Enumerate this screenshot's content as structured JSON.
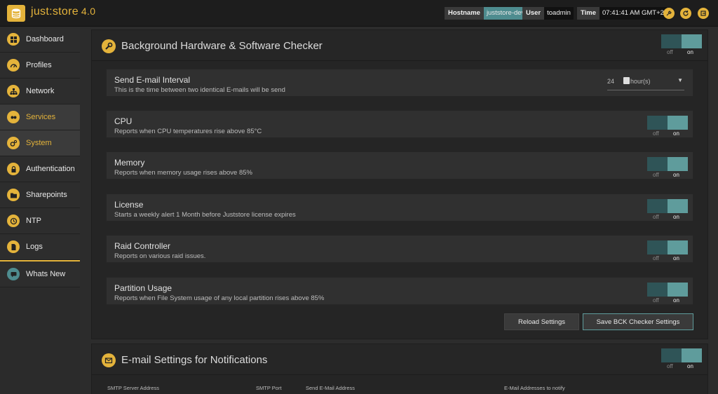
{
  "app": {
    "brand": "just:store",
    "version": "4.0"
  },
  "topbar": {
    "hostname_label": "Hostname",
    "hostname_value": "juststore-dev",
    "user_label": "User",
    "user_value": "toadmin",
    "time_label": "Time",
    "time_value": "07:41:41 AM GMT+2",
    "icons": [
      "tools-icon",
      "refresh-icon",
      "logout-icon"
    ]
  },
  "sidebar": {
    "items": [
      {
        "label": "Dashboard",
        "icon": "dashboard-icon"
      },
      {
        "label": "Profiles",
        "icon": "gauge-icon"
      },
      {
        "label": "Network",
        "icon": "network-icon"
      },
      {
        "label": "Services",
        "icon": "services-icon",
        "active": true
      },
      {
        "label": "System",
        "icon": "gears-icon",
        "active": true
      },
      {
        "label": "Authentication",
        "icon": "lock-icon"
      },
      {
        "label": "Sharepoints",
        "icon": "folder-icon"
      },
      {
        "label": "NTP",
        "icon": "clock-icon"
      },
      {
        "label": "Logs",
        "icon": "document-icon"
      },
      {
        "label": "Whats New",
        "icon": "chat-icon"
      }
    ]
  },
  "bck_panel": {
    "title": "Background Hardware & Software Checker",
    "toggle": {
      "off": "off",
      "on": "on"
    },
    "interval": {
      "title": "Send E-mail Interval",
      "description": "This is the time between two identical E-mails will be send",
      "value": "24",
      "unit": "hour(s)"
    },
    "rows": [
      {
        "title": "CPU",
        "description": "Reports when CPU temperatures rise above 85°C"
      },
      {
        "title": "Memory",
        "description": "Reports when memory usage rises above 85%"
      },
      {
        "title": "License",
        "description": "Starts a weekly alert 1 Month before Juststore license expires"
      },
      {
        "title": "Raid Controller",
        "description": "Reports on various raid issues."
      },
      {
        "title": "Partition Usage",
        "description": "Reports when File System usage of any local partition rises above 85%"
      }
    ],
    "reload_label": "Reload Settings",
    "save_label": "Save BCK Checker Settings"
  },
  "email_panel": {
    "title": "E-mail Settings for Notifications",
    "toggle": {
      "off": "off",
      "on": "on"
    },
    "fields": {
      "smtp_server_label": "SMTP Server Address",
      "smtp_port_label": "SMTP Port",
      "send_address_label": "Send E-Mail Address",
      "notify_label": "E-Mail Addresses to notify"
    }
  },
  "colors": {
    "accent": "#e4b33b",
    "teal": "#5f9c9c",
    "teal_dark": "#2f5457",
    "background": "#2a2a2a"
  }
}
